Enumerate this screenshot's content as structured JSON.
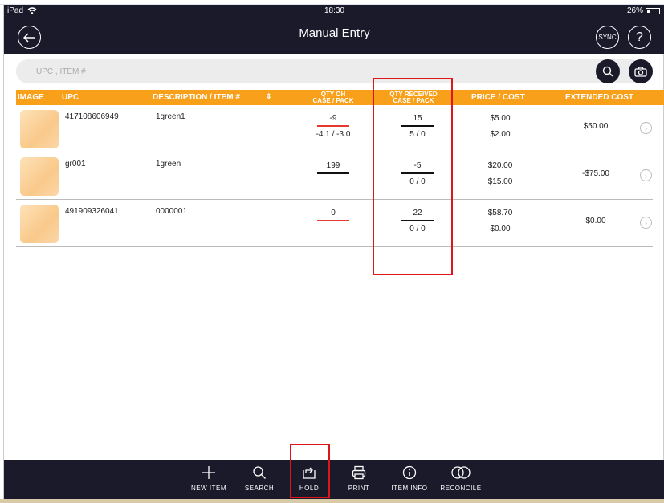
{
  "status_bar": {
    "device": "iPad",
    "time": "18:30",
    "battery": "26%"
  },
  "header": {
    "title": "Manual Entry",
    "back_icon": "arrow-left-icon",
    "sync_label": "SYNC",
    "help_label": "?"
  },
  "search": {
    "placeholder": "UPC , ITEM #",
    "search_icon": "search-icon",
    "camera_icon": "camera-icon"
  },
  "columns": {
    "image": "IMAGE",
    "upc": "UPC",
    "description": "DESCRIPTION / ITEM #",
    "qty_oh": "QTY OH",
    "qty_oh_sub": "CASE / PACK",
    "qty_received": "QTY RECEIVED",
    "qty_received_sub": "CASE / PACK",
    "price_cost": "PRICE / COST",
    "extended_cost": "EXTENDED COST"
  },
  "rows": [
    {
      "upc": "417108606949",
      "description": "1green1",
      "qty_oh": "-9",
      "qty_oh_sub": "-4.1 / -3.0",
      "qty_received": "15",
      "qty_received_sub": "5 / 0",
      "price": "$5.00",
      "cost": "$2.00",
      "extended": "$50.00"
    },
    {
      "upc": "gr001",
      "description": "1green",
      "qty_oh": "199",
      "qty_oh_sub": "",
      "qty_received": "-5",
      "qty_received_sub": "0 / 0",
      "price": "$20.00",
      "cost": "$15.00",
      "extended": "-$75.00"
    },
    {
      "upc": "491909326041",
      "description": "0000001",
      "qty_oh": "0",
      "qty_oh_sub": "",
      "qty_received": "22",
      "qty_received_sub": "0 / 0",
      "price": "$58.70",
      "cost": "$0.00",
      "extended": "$0.00"
    }
  ],
  "toolbar": [
    {
      "label": "NEW ITEM",
      "icon": "plus-icon"
    },
    {
      "label": "SEARCH",
      "icon": "search-icon"
    },
    {
      "label": "HOLD",
      "icon": "hold-icon"
    },
    {
      "label": "PRINT",
      "icon": "printer-icon"
    },
    {
      "label": "ITEM INFO",
      "icon": "info-icon"
    },
    {
      "label": "RECONCILE",
      "icon": "reconcile-icon"
    }
  ],
  "colors": {
    "header_bg": "#1b1a2b",
    "accent": "#f9a01b",
    "highlight": "#e0151a",
    "negative_underline": "#e53a2f"
  }
}
